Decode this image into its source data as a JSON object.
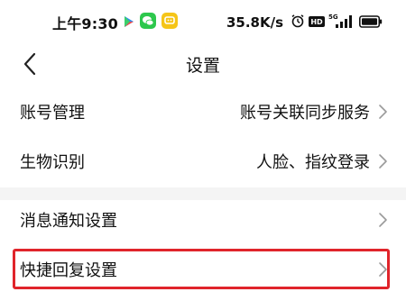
{
  "status_bar": {
    "time": "上午9:30",
    "net_speed": "35.8K/s",
    "icons": [
      "play-store-icon",
      "wechat-icon",
      "chat-app-icon",
      "alarm-icon",
      "hd-icon",
      "signal-5g-icon",
      "battery-icon"
    ],
    "hd_label": "HD",
    "network_label": "5G"
  },
  "header": {
    "title": "设置"
  },
  "rows": [
    {
      "label": "账号管理",
      "value": "账号关联同步服务"
    },
    {
      "label": "生物识别",
      "value": "人脸、指纹登录"
    },
    {
      "label": "消息通知设置",
      "value": ""
    },
    {
      "label": "快捷回复设置",
      "value": ""
    }
  ],
  "colors": {
    "highlight": "#e0242b",
    "wechat_green": "#2dc84d",
    "app_yellow": "#f5c518",
    "section_gap": "#f4f4f4"
  }
}
